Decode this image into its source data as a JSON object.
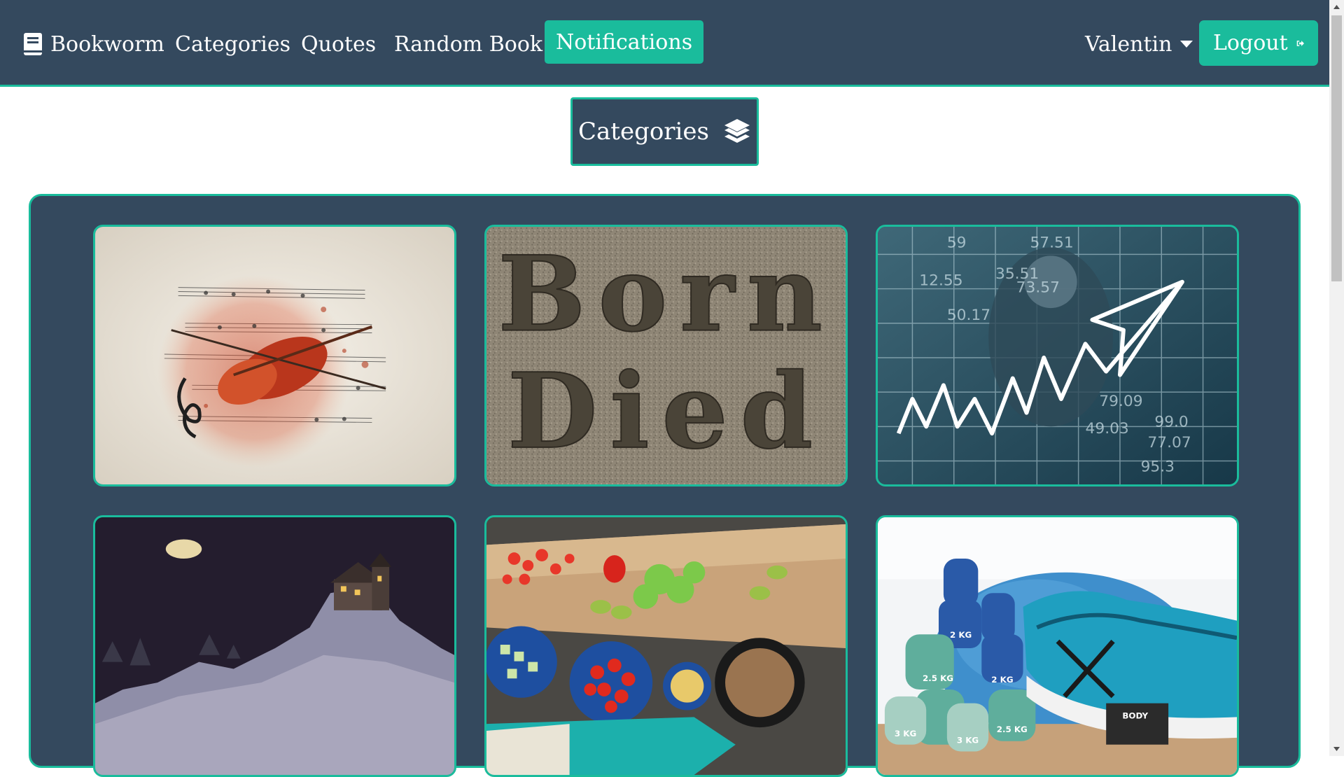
{
  "navbar": {
    "brand": "Bookworm",
    "items": [
      "Categories",
      "Quotes",
      "Random Book"
    ],
    "notifications": "Notifications",
    "user": "Valentin",
    "logout": "Logout"
  },
  "section": {
    "title": "Categories"
  },
  "categories": {
    "cards": [
      {
        "image": "music-violet-sheet-music"
      },
      {
        "image": "stone-engraving-born-died",
        "engraving_line1": "Born",
        "engraving_line2": "Died"
      },
      {
        "image": "business-man-rising-chart",
        "numbers": [
          "59",
          "57.51",
          "12.55",
          "35.51",
          "73.57",
          "50.17",
          "79.09",
          "99.0",
          "77.07",
          "49.03",
          "95.3"
        ]
      },
      {
        "image": "night-castle-hill"
      },
      {
        "image": "cooking-vegetables"
      },
      {
        "image": "dumbbells-sneaker",
        "weights": [
          "2 KG",
          "2.5 KG",
          "2 KG",
          "3 KG",
          "3 KG",
          "2.5 KG"
        ],
        "shoe_label": "BODY"
      }
    ]
  },
  "colors": {
    "navbar_bg": "#34495e",
    "accent": "#1abc9c",
    "text": "#ffffff"
  }
}
